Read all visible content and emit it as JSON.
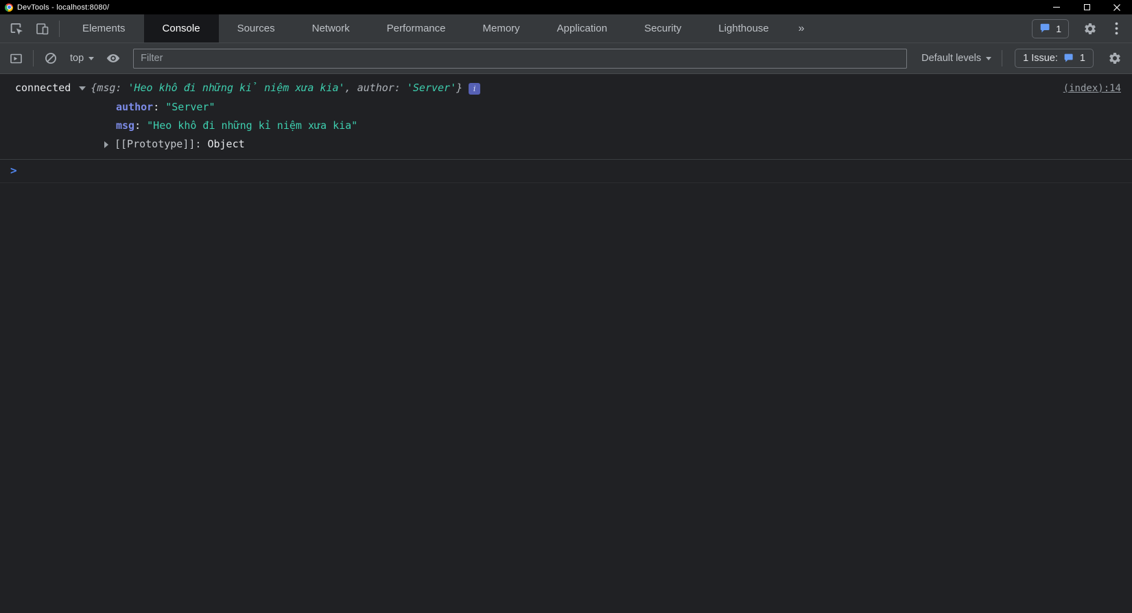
{
  "colors": {
    "accent_blue": "#669cf4",
    "string_teal": "#3ecfaf",
    "property_blue": "#7d8ce8",
    "link_gray": "#9aa0a6",
    "info_badge_indigo": "#5661b5",
    "active_tab_bg": "#17181b",
    "toolbar_bg": "#36393c",
    "console_bg": "#202124"
  },
  "window": {
    "title": "DevTools - localhost:8080/"
  },
  "tabbar": {
    "tabs": [
      {
        "label": "Elements"
      },
      {
        "label": "Console"
      },
      {
        "label": "Sources"
      },
      {
        "label": "Network"
      },
      {
        "label": "Performance"
      },
      {
        "label": "Memory"
      },
      {
        "label": "Application"
      },
      {
        "label": "Security"
      },
      {
        "label": "Lighthouse"
      }
    ],
    "active_tab": "Console",
    "more_label": "»",
    "messages_count": "1"
  },
  "toolbar": {
    "context_selector": "top",
    "filter_placeholder": "Filter",
    "levels_label": "Default levels",
    "issues_label": "1 Issue:",
    "issues_count": "1"
  },
  "console": {
    "message": {
      "prefix": "connected",
      "preview": {
        "open": "{",
        "key1": "msg",
        "sep": ": ",
        "val1": "'Heo khô đi những kỉ niệm xưa kia'",
        "comma": ", ",
        "key2": "author",
        "val2": "'Server'",
        "close": "}"
      },
      "info_badge": "i",
      "source": "(index):14",
      "properties": [
        {
          "key": "author",
          "sep": ": ",
          "value": "\"Server\""
        },
        {
          "key": "msg",
          "sep": ": ",
          "value": "\"Heo khô đi những kỉ niệm xưa kia\""
        }
      ],
      "prototype": {
        "key": "[[Prototype]]",
        "sep": ": ",
        "value": "Object"
      }
    },
    "prompt": ">"
  }
}
